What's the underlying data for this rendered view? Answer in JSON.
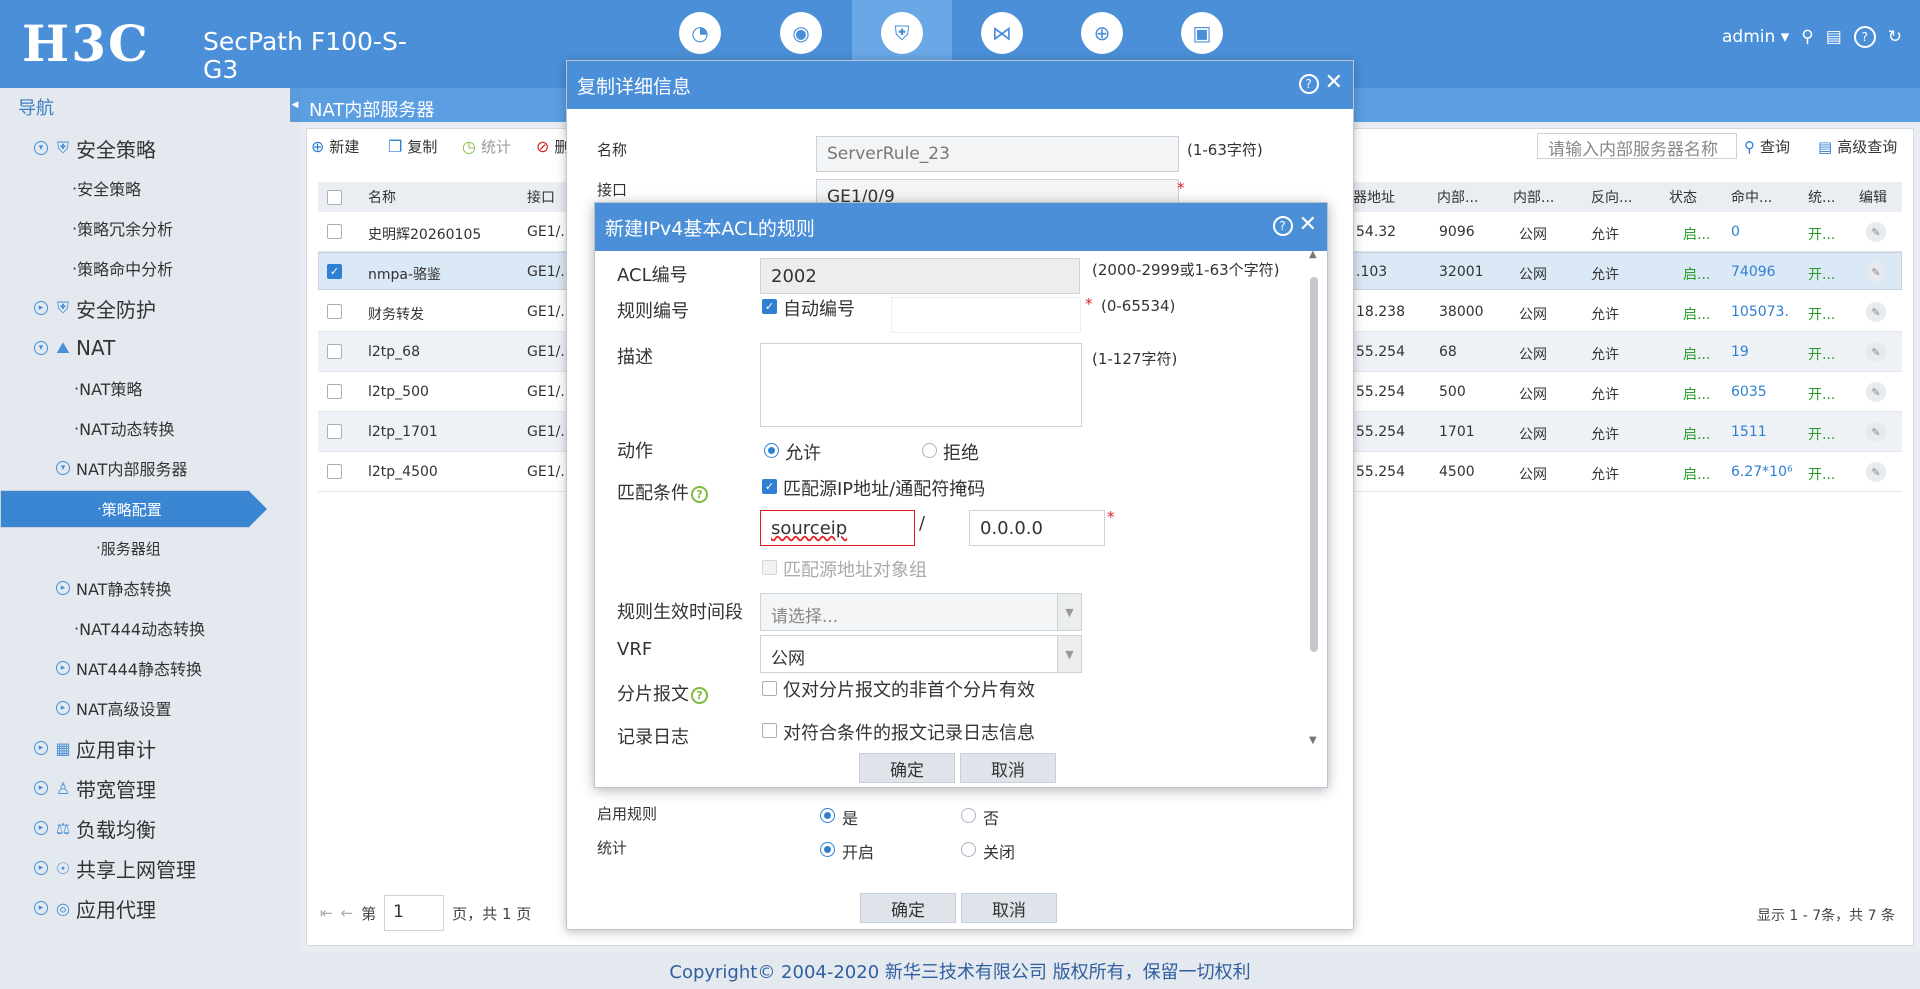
{
  "header": {
    "logo": "H3C",
    "product": "SecPath F100-S-G3",
    "user": "admin",
    "nav_icons": [
      "dashboard-icon",
      "monitor-icon",
      "policy-icon",
      "network-icon",
      "system-icon",
      "device-icon"
    ]
  },
  "nav": {
    "title": "导航",
    "items": [
      {
        "label": "安全策略",
        "level": 1
      },
      {
        "label": "安全策略",
        "level": 3
      },
      {
        "label": "策略冗余分析",
        "level": 3
      },
      {
        "label": "策略命中分析",
        "level": 3
      },
      {
        "label": "安全防护",
        "level": 1
      },
      {
        "label": "NAT",
        "level": 1
      },
      {
        "label": "NAT策略",
        "level": 3
      },
      {
        "label": "NAT动态转换",
        "level": 3
      },
      {
        "label": "NAT内部服务器",
        "level": 2
      },
      {
        "label": "策略配置",
        "level": 4
      },
      {
        "label": "服务器组",
        "level": 4
      },
      {
        "label": "NAT静态转换",
        "level": 2
      },
      {
        "label": "NAT444动态转换",
        "level": 3
      },
      {
        "label": "NAT444静态转换",
        "level": 2
      },
      {
        "label": "NAT高级设置",
        "level": 2
      },
      {
        "label": "应用审计",
        "level": 1
      },
      {
        "label": "带宽管理",
        "level": 1
      },
      {
        "label": "负载均衡",
        "level": 1
      },
      {
        "label": "共享上网管理",
        "level": 1
      },
      {
        "label": "应用代理",
        "level": 1
      }
    ]
  },
  "tab": "NAT内部服务器",
  "toolbar": {
    "new": "新建",
    "copy": "复制",
    "stats": "统计",
    "delete": "删",
    "search_placeholder": "请输入内部服务器名称",
    "search": "查询",
    "advanced": "高级查询"
  },
  "table": {
    "headers": {
      "name": "名称",
      "iface": "接口",
      "addr": "器地址",
      "inner1": "内部...",
      "inner2": "内部...",
      "reverse": "反向...",
      "status": "状态",
      "hits": "命中...",
      "stat": "统...",
      "edit": "编辑"
    },
    "rows": [
      {
        "name": "史明辉20260105",
        "iface": "GE1/...",
        "addr": "54.32",
        "port": "9096",
        "vpn": "公网",
        "reverse": "允许",
        "status": "启...",
        "hits": "0",
        "stat": "开..."
      },
      {
        "name": "nmpa-骆鉴",
        "iface": "GE1/...",
        "addr": ".103",
        "port": "32001",
        "vpn": "公网",
        "reverse": "允许",
        "status": "启...",
        "hits": "74096",
        "stat": "开..."
      },
      {
        "name": "财务转发",
        "iface": "GE1/...",
        "addr": "18.238",
        "port": "38000",
        "vpn": "公网",
        "reverse": "允许",
        "status": "启...",
        "hits": "105073.",
        "stat": "开..."
      },
      {
        "name": "l2tp_68",
        "iface": "GE1/...",
        "addr": "55.254",
        "port": "68",
        "vpn": "公网",
        "reverse": "允许",
        "status": "启...",
        "hits": "19",
        "stat": "开..."
      },
      {
        "name": "l2tp_500",
        "iface": "GE1/...",
        "addr": "55.254",
        "port": "500",
        "vpn": "公网",
        "reverse": "允许",
        "status": "启...",
        "hits": "6035",
        "stat": "开..."
      },
      {
        "name": "l2tp_1701",
        "iface": "GE1/...",
        "addr": "55.254",
        "port": "1701",
        "vpn": "公网",
        "reverse": "允许",
        "status": "启...",
        "hits": "1511",
        "stat": "开..."
      },
      {
        "name": "l2tp_4500",
        "iface": "GE1/...",
        "addr": "55.254",
        "port": "4500",
        "vpn": "公网",
        "reverse": "允许",
        "status": "启...",
        "hits": "6.27*10⁶",
        "stat": "开..."
      }
    ]
  },
  "pager": {
    "prefix": "第",
    "page": "1",
    "suffix": "页，共 1 页",
    "summary": "显示 1 - 7条，共 7 条"
  },
  "footer": "Copyright© 2004-2020 新华三技术有限公司 版权所有，保留一切权利",
  "dialog1": {
    "title": "复制详细信息",
    "name_label": "名称",
    "name_value": "ServerRule_23",
    "name_hint": "(1-63字符)",
    "iface_label": "接口",
    "iface_value": "GE1/0/9",
    "enable_label": "启用规则",
    "enable_yes": "是",
    "enable_no": "否",
    "stat_label": "统计",
    "stat_on": "开启",
    "stat_off": "关闭",
    "ok": "确定",
    "cancel": "取消"
  },
  "dialog2": {
    "title": "新建IPv4基本ACL的规则",
    "acl_label": "ACL编号",
    "acl_value": "2002",
    "acl_hint": "(2000-2999或1-63个字符)",
    "rule_label": "规则编号",
    "auto_number": "自动编号",
    "rule_hint": "(0-65534)",
    "desc_label": "描述",
    "desc_hint": "(1-127字符)",
    "action_label": "动作",
    "permit": "允许",
    "deny": "拒绝",
    "match_label": "匹配条件",
    "match_src": "匹配源IP地址/通配符掩码",
    "src_ip": "sourceip",
    "wildcard": "0.0.0.0",
    "match_obj": "匹配源地址对象组",
    "time_label": "规则生效时间段",
    "time_placeholder": "请选择...",
    "vrf_label": "VRF",
    "vrf_value": "公网",
    "frag_label": "分片报文",
    "frag_text": "仅对分片报文的非首个分片有效",
    "log_label": "记录日志",
    "log_text": "对符合条件的报文记录日志信息",
    "ok": "确定",
    "cancel": "取消"
  }
}
